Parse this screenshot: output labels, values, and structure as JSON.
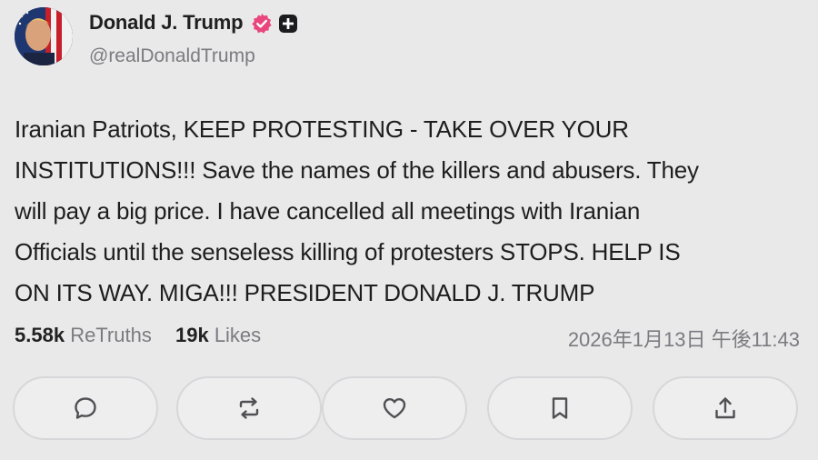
{
  "author": {
    "display_name": "Donald J. Trump",
    "handle": "@realDonaldTrump",
    "badges": [
      "verified-badge-icon",
      "plus-badge-icon"
    ]
  },
  "post": {
    "text": "Iranian Patriots, KEEP PROTESTING - TAKE OVER YOUR\nINSTITUTIONS!!! Save the names of the killers and abusers. They\nwill pay a big price. I have cancelled all meetings with Iranian\nOfficials until the senseless killing of protesters STOPS. HELP IS\nON ITS WAY. MIGA!!! PRESIDENT DONALD J. TRUMP"
  },
  "stats": {
    "retruths_count": "5.58k",
    "retruths_label": "ReTruths",
    "likes_count": "19k",
    "likes_label": "Likes"
  },
  "timestamp": "2026年1月13日 午後11:43",
  "actions": [
    {
      "name": "reply",
      "icon": "comment-bubble-icon"
    },
    {
      "name": "retruth",
      "icon": "repost-arrows-icon"
    },
    {
      "name": "like",
      "icon": "heart-icon"
    },
    {
      "name": "bookmark",
      "icon": "bookmark-icon"
    },
    {
      "name": "share",
      "icon": "share-upload-icon"
    }
  ],
  "colors": {
    "background": "#e9e9ea",
    "verified_badge": "#e8467c",
    "text": "#1e1e1e",
    "muted": "#7b7b80"
  }
}
